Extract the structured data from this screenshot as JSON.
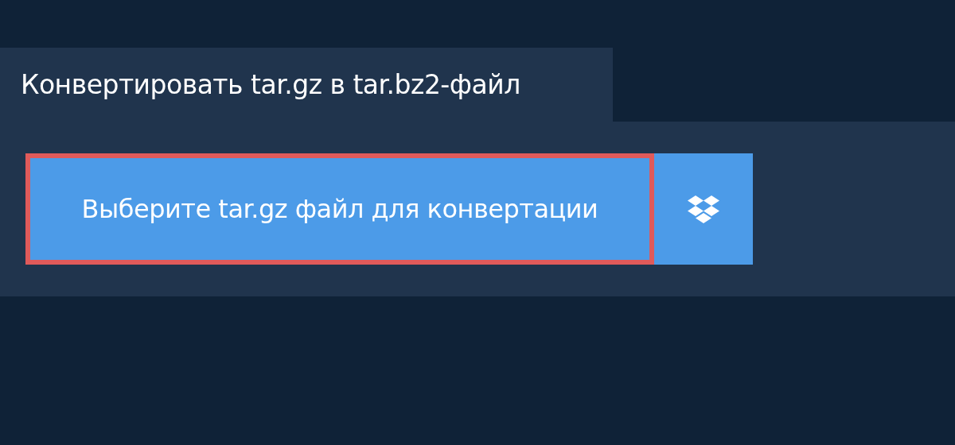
{
  "tab": {
    "title": "Конвертировать tar.gz в tar.bz2-файл"
  },
  "upload": {
    "label": "Выберите tar.gz файл для конвертации",
    "focused": true
  }
}
